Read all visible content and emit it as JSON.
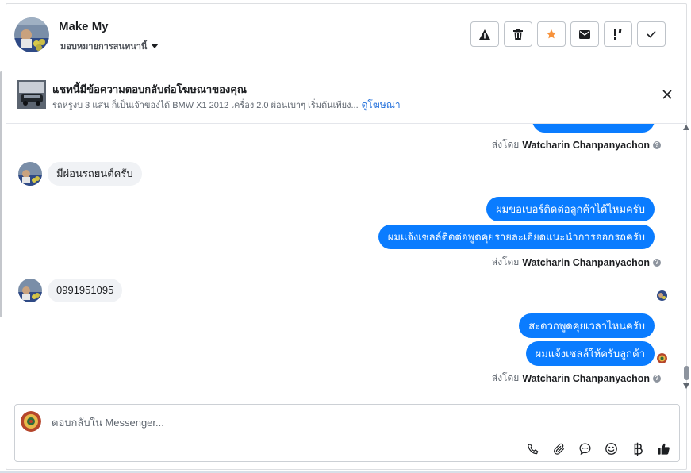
{
  "header": {
    "title": "Make My",
    "assign_label": "มอบหมายการสนทนานี้",
    "actions": [
      {
        "name": "report-spam-button",
        "icon": "warning-icon"
      },
      {
        "name": "delete-button",
        "icon": "trash-icon"
      },
      {
        "name": "star-button",
        "icon": "star-icon"
      },
      {
        "name": "mark-unread-button",
        "icon": "envelope-icon"
      },
      {
        "name": "follow-up-button",
        "icon": "exclamation-icon"
      },
      {
        "name": "mark-done-button",
        "icon": "check-icon"
      }
    ]
  },
  "ad_banner": {
    "title": "แชทนี้มีข้อความตอบกลับต่อโฆษณาของคุณ",
    "description": "รถหรูงบ 3 แสน ก็เป็นเจ้าของได้ BMW X1 2012 เครื่อง 2.0 ผ่อนเบาๆ เริ่มต้นเพียง...",
    "link_label": "ดูโฆษณา"
  },
  "messages": {
    "sent_by_prefix": "ส่งโดย",
    "agent_name": "Watcharin Chanpanyachon",
    "incoming_1": "มีผ่อนรถยนต์ครับ",
    "outgoing_1": "ผมขอเบอร์ติดต่อลูกค้าได้ไหมครับ",
    "outgoing_2": "ผมแจ้งเซลล์ติดต่อพูดคุยรายละเอียดแนะนำการออกรถครับ",
    "incoming_2": "0991951095",
    "outgoing_3": "สะดวกพูดคุยเวลาไหนครับ",
    "outgoing_4": "ผมแจ้งเซลล์ให้ครับลูกค้า"
  },
  "composer": {
    "placeholder": "ตอบกลับใน Messenger...",
    "tools": [
      "phone-icon",
      "attachment-icon",
      "saved-reply-icon",
      "emoji-icon",
      "baht-icon",
      "thumbs-up-icon"
    ]
  },
  "colors": {
    "outgoing_bubble": "#0a7cff",
    "incoming_bubble": "#f0f2f5",
    "star": "#f7923b",
    "link": "#216fdb"
  }
}
